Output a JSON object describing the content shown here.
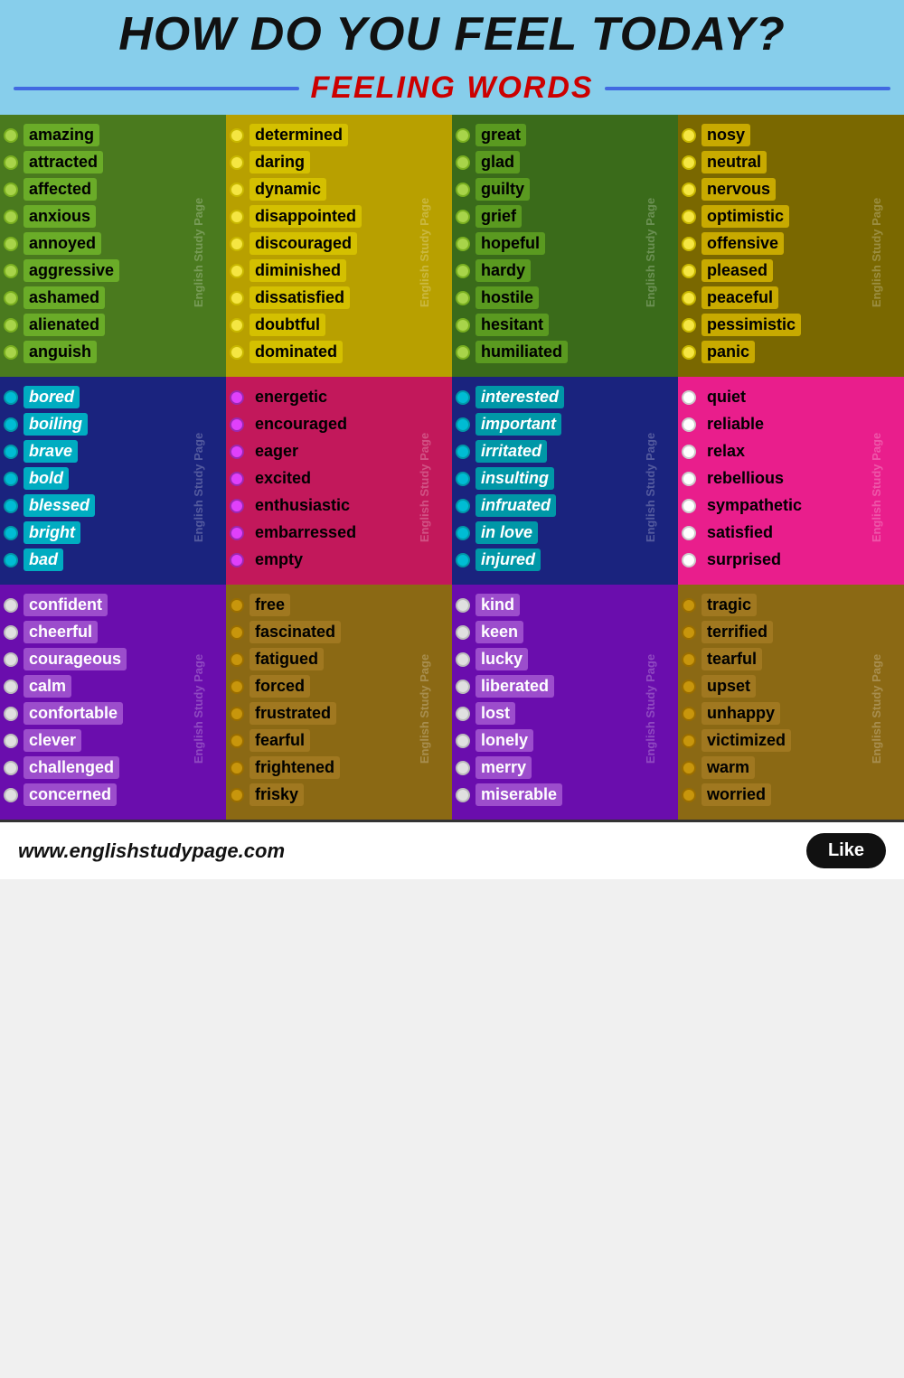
{
  "header": {
    "main_title": "HOW DO YOU FEEL TODAY?",
    "subtitle": "FEELING WORDS"
  },
  "grid": {
    "rows": [
      {
        "cells": [
          {
            "id": "r1c1",
            "words": [
              "amazing",
              "attracted",
              "affected",
              "anxious",
              "annoyed",
              "aggressive",
              "ashamed",
              "alienated",
              "anguish"
            ]
          },
          {
            "id": "r1c2",
            "words": [
              "determined",
              "daring",
              "dynamic",
              "disappointed",
              "discouraged",
              "diminished",
              "dissatisfied",
              "doubtful",
              "dominated"
            ]
          },
          {
            "id": "r1c3",
            "words": [
              "great",
              "glad",
              "guilty",
              "grief",
              "hopeful",
              "hardy",
              "hostile",
              "hesitant",
              "humiliated"
            ]
          },
          {
            "id": "r1c4",
            "words": [
              "nosy",
              "neutral",
              "nervous",
              "optimistic",
              "offensive",
              "pleased",
              "peaceful",
              "pessimistic",
              "panic"
            ]
          }
        ]
      },
      {
        "cells": [
          {
            "id": "r2c1",
            "words": [
              "bored",
              "boiling",
              "brave",
              "bold",
              "blessed",
              "bright",
              "bad"
            ]
          },
          {
            "id": "r2c2",
            "words": [
              "energetic",
              "encouraged",
              "eager",
              "excited",
              "enthusiastic",
              "embarressed",
              "empty"
            ]
          },
          {
            "id": "r2c3",
            "words": [
              "interested",
              "important",
              "irritated",
              "insulting",
              "infruated",
              "in love",
              "injured"
            ]
          },
          {
            "id": "r2c4",
            "words": [
              "quiet",
              "reliable",
              "relax",
              "rebellious",
              "sympathetic",
              "satisfied",
              "surprised"
            ]
          }
        ]
      },
      {
        "cells": [
          {
            "id": "r3c1",
            "words": [
              "confident",
              "cheerful",
              "courageous",
              "calm",
              "confortable",
              "clever",
              "challenged",
              "concerned"
            ]
          },
          {
            "id": "r3c2",
            "words": [
              "free",
              "fascinated",
              "fatigued",
              "forced",
              "frustrated",
              "fearful",
              "frightened",
              "frisky"
            ]
          },
          {
            "id": "r3c3",
            "words": [
              "kind",
              "keen",
              "lucky",
              "liberated",
              "lost",
              "lonely",
              "merry",
              "miserable"
            ]
          },
          {
            "id": "r3c4",
            "words": [
              "tragic",
              "terrified",
              "tearful",
              "upset",
              "unhappy",
              "victimized",
              "warm",
              "worried"
            ]
          }
        ]
      }
    ]
  },
  "footer": {
    "url": "www.englishstudypage.com",
    "like_label": "Like"
  }
}
